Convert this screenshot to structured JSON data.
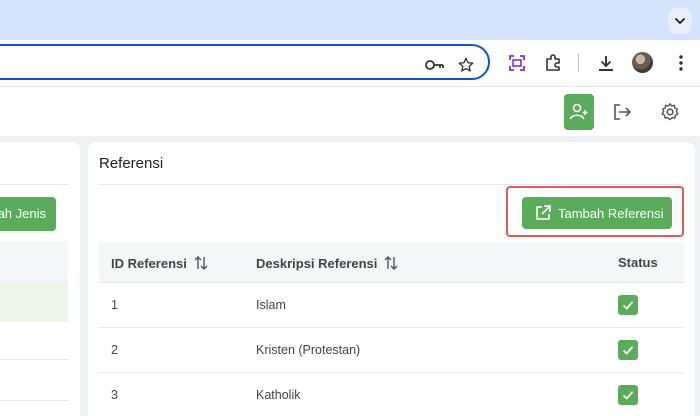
{
  "browser": {
    "icons": [
      "key-icon",
      "star-icon",
      "screenshot-icon",
      "extensions-icon",
      "download-icon",
      "more-vert-icon"
    ]
  },
  "header": {
    "icons": [
      "add-user-icon",
      "logout-icon",
      "settings-icon"
    ]
  },
  "left_panel": {
    "button_label": "ah Jenis"
  },
  "card": {
    "title": "Referensi",
    "add_button_label": "Tambah Referensi",
    "columns": [
      "ID Referensi",
      "Deskripsi Referensi",
      "Status"
    ],
    "rows": [
      {
        "id": "1",
        "deskripsi": "Islam",
        "status": true
      },
      {
        "id": "2",
        "deskripsi": "Kristen (Protestan)",
        "status": true
      },
      {
        "id": "3",
        "deskripsi": "Katholik",
        "status": true
      }
    ]
  },
  "colors": {
    "accent_green": "#5aac5b",
    "highlight_red": "#e45a58",
    "browser_blue": "#0b57d0"
  }
}
